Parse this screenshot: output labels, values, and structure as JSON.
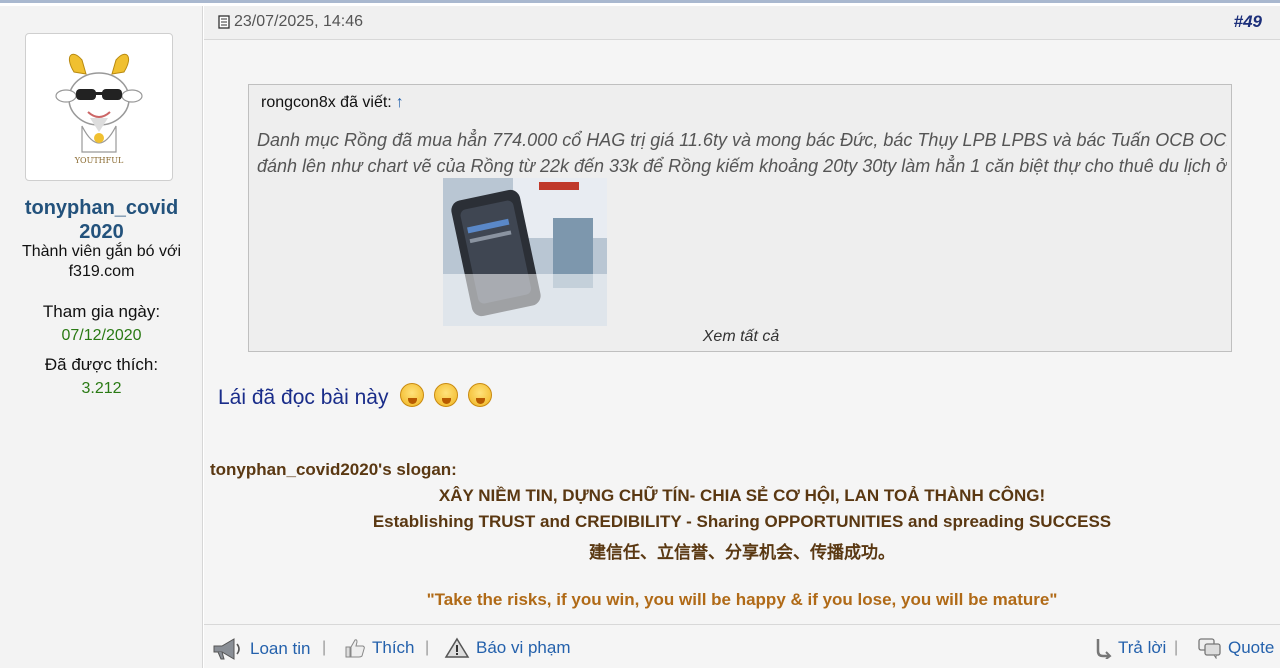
{
  "user": {
    "name": "tonyphan_covid2020",
    "name_line1": "tonyphan_covid",
    "name_line2": "2020",
    "title": "Thành viên gắn bó với f319.com",
    "avatar_text": "YOUTHFUL",
    "join_label": "Tham gia ngày:",
    "join_date": "07/12/2020",
    "likes_label": "Đã được thích:",
    "likes_value": "3.212"
  },
  "post": {
    "date": "23/07/2025, 14:46",
    "number": "#49",
    "quote_author": "rongcon8x đã viết:",
    "quote_arrow": "↑",
    "quote_line1": "Danh mục Rồng đã mua hẳn 774.000 cổ HAG trị giá 11.6ty và mong bác Đức, bác Thụy LPB LPBS và bác Tuấn OCB OCBS",
    "quote_line2": "đánh lên như chart vẽ của Rồng từ 22k đến 33k để Rồng kiếm khoảng 20ty 30ty làm hẳn 1 căn biệt thự cho thuê du lịch ở",
    "see_all": "Xem tất cả",
    "reply_text": "Lái đã đọc bài này",
    "slogan_label": "tonyphan_covid2020's slogan:",
    "slogan_vi": "XÂY NIỀM TIN, DỰNG CHỮ TÍN- CHIA SẺ CƠ HỘI, LAN TOẢ THÀNH CÔNG!",
    "slogan_en": "Establishing TRUST and CREDIBILITY - Sharing OPPORTUNITIES and spreading SUCCESS",
    "slogan_zh": "建信任、立信誉、分享机会、传播成功。",
    "slogan_quote": "\"Take the risks, if you win, you will be happy & if you lose, you will be mature\""
  },
  "footer": {
    "share": "Loan tin",
    "like": "Thích",
    "report": "Báo vi phạm",
    "reply": "Trả lời",
    "quote": "Quote",
    "separator": "|"
  }
}
